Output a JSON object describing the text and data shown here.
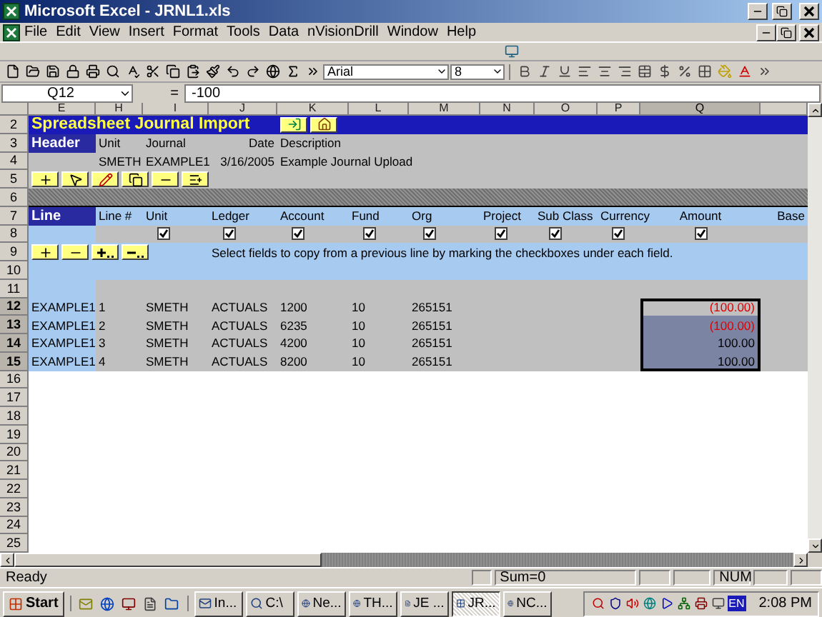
{
  "window": {
    "title": "Microsoft Excel - JRNL1.xls"
  },
  "menu": [
    "File",
    "Edit",
    "View",
    "Insert",
    "Format",
    "Tools",
    "Data",
    "nVisionDrill",
    "Window",
    "Help"
  ],
  "toolbar": {
    "font": "Arial",
    "size": "8"
  },
  "formula_bar": {
    "cell": "Q12",
    "equals": "=",
    "value": "-100"
  },
  "columns": [
    {
      "label": "E",
      "selected": false
    },
    {
      "label": "H",
      "selected": false
    },
    {
      "label": "I",
      "selected": false
    },
    {
      "label": "J",
      "selected": false
    },
    {
      "label": "K",
      "selected": false
    },
    {
      "label": "L",
      "selected": false
    },
    {
      "label": "M",
      "selected": false
    },
    {
      "label": "N",
      "selected": false
    },
    {
      "label": "O",
      "selected": false
    },
    {
      "label": "P",
      "selected": false
    },
    {
      "label": "Q",
      "selected": true
    }
  ],
  "sheet": {
    "title_row": {
      "number": "2",
      "title": "Spreadsheet Journal Import"
    },
    "header": {
      "label_row": "3",
      "value_row": "4",
      "section": "Header",
      "labels": [
        "Unit",
        "Journal",
        "Date",
        "Description"
      ],
      "values": [
        "SMETH",
        "EXAMPLE1",
        "3/16/2005",
        "Example Journal Upload"
      ]
    },
    "header_buttons_row": "5",
    "separator_row": "6",
    "line": {
      "label_row": "7",
      "section": "Line",
      "labels": [
        "Line #",
        "Unit",
        "Ledger",
        "Account",
        "Fund",
        "Org",
        "Project",
        "Sub Class",
        "Currency",
        "Amount",
        "Base"
      ],
      "checkbox_row": "8",
      "checkboxes": [
        {
          "checked": true
        },
        {
          "checked": true
        },
        {
          "checked": true
        },
        {
          "checked": true
        },
        {
          "checked": true
        },
        {
          "checked": true
        },
        {
          "checked": true
        },
        {
          "checked": true
        },
        {
          "checked": true
        }
      ],
      "buttons_row": "9",
      "hint": "Select fields to copy from a previous line by marking the checkboxes under each field."
    },
    "blank_rows": [
      {
        "number": "10",
        "kind": "band"
      },
      {
        "number": "11",
        "kind": "gap"
      }
    ],
    "data_rows": [
      {
        "number": "12",
        "selected": true,
        "cells": [
          "EXAMPLE1",
          "1",
          "SMETH",
          "ACTUALS",
          "1200",
          "10",
          "265151"
        ],
        "amount": {
          "text": "(100.00)",
          "negative": true,
          "highlighted": false
        }
      },
      {
        "number": "13",
        "selected": true,
        "cells": [
          "EXAMPLE1",
          "2",
          "SMETH",
          "ACTUALS",
          "6235",
          "10",
          "265151"
        ],
        "amount": {
          "text": "(100.00)",
          "negative": true,
          "highlighted": true
        }
      },
      {
        "number": "14",
        "selected": true,
        "cells": [
          "EXAMPLE1",
          "3",
          "SMETH",
          "ACTUALS",
          "4200",
          "10",
          "265151"
        ],
        "amount": {
          "text": "100.00",
          "negative": false,
          "highlighted": true
        }
      },
      {
        "number": "15",
        "selected": true,
        "cells": [
          "EXAMPLE1",
          "4",
          "SMETH",
          "ACTUALS",
          "8200",
          "10",
          "265151"
        ],
        "amount": {
          "text": "100.00",
          "negative": false,
          "highlighted": true
        }
      }
    ],
    "empty_rows": [
      "16",
      "17",
      "18",
      "19",
      "20",
      "21",
      "22",
      "23",
      "24",
      "25"
    ]
  },
  "status_bar": {
    "mode": "Ready",
    "sum": "Sum=0",
    "num": "NUM"
  },
  "taskbar": {
    "start": "Start",
    "tasks": [
      {
        "label": "In...",
        "selected": false
      },
      {
        "label": "C:\\",
        "selected": false
      },
      {
        "label": "Ne...",
        "selected": false
      },
      {
        "label": "TH...",
        "selected": false
      },
      {
        "label": "JE ...",
        "selected": false
      },
      {
        "label": "JR...",
        "selected": true
      },
      {
        "label": "NC...",
        "selected": false
      }
    ],
    "language": "EN",
    "clock": "2:08 PM"
  }
}
